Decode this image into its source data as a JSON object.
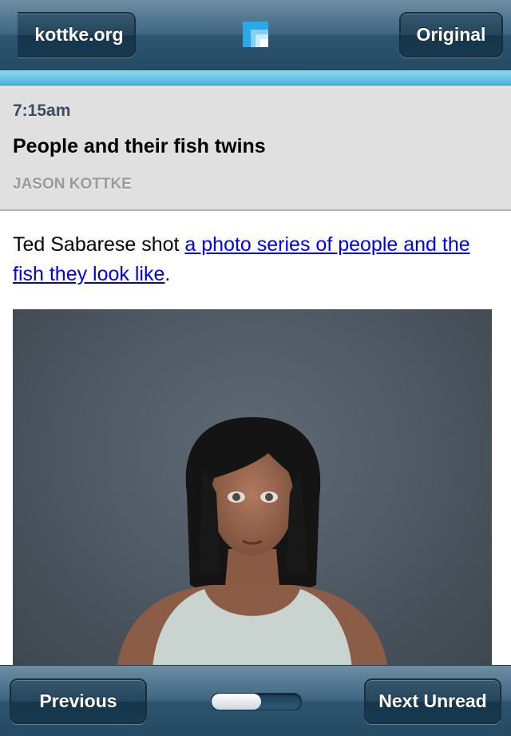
{
  "navbar": {
    "back_label": "kottke.org",
    "original_label": "Original",
    "logo_icon": "app-logo-icon",
    "accent_color": "#4ab6dc"
  },
  "article": {
    "time": "7:15am",
    "title": "People and their fish twins",
    "author": "JASON KOTTKE",
    "body_prefix": "Ted Sabarese shot ",
    "body_link": "a photo series of people and the fish they look like",
    "body_suffix": ".",
    "photo_icon": "portrait-photo"
  },
  "toolbar": {
    "previous_label": "Previous",
    "next_label": "Next Unread",
    "progress_fraction": 0.55
  }
}
